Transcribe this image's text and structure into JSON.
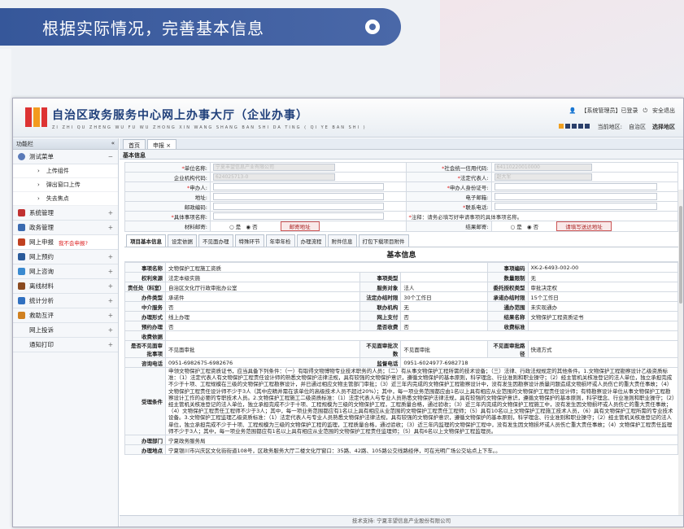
{
  "banner": {
    "title": "根据实际情况，完善基本信息"
  },
  "header": {
    "title": "自治区政务服务中心网上办事大厅（企业办事）",
    "pinyin": "ZI ZHI QU ZHENG WU FU WU ZHONG XIN WANG SHANG BAN SHI DA TING ( QI YE BAN SHI )",
    "user_text": "【系统管理员】已登录",
    "logout": "安全退出",
    "region_label": "当前地区:",
    "region": "自治区",
    "select_region": "选择地区"
  },
  "sidebar": {
    "title": "功能栏",
    "collapse": "«",
    "items": [
      {
        "label": "测试菜单",
        "expanded": true,
        "color": "#5a7ab8"
      },
      {
        "label": "系统管理",
        "color": "#c03030"
      },
      {
        "label": "政务管理",
        "color": "#3a6ab0"
      },
      {
        "label": "网上申报",
        "note": "我不会申报?",
        "color": "#c04020"
      },
      {
        "label": "网上预约",
        "color": "#2a5a9a"
      },
      {
        "label": "网上咨询",
        "color": "#3a8ad0"
      },
      {
        "label": "离线材料",
        "color": "#8a4a20"
      },
      {
        "label": "统计分析",
        "color": "#3070c0"
      },
      {
        "label": "救助互评",
        "color": "#d08020"
      },
      {
        "label": "网上投诉"
      },
      {
        "label": "通知打印"
      }
    ],
    "subitems": [
      "上传组件",
      "弹出窗口上传",
      "失去焦点"
    ]
  },
  "tabs": [
    "首页",
    "申报 ×"
  ],
  "basic_section": "基本信息",
  "form": {
    "unit_name": "单位名称:",
    "unit_name_value": "宁夏丰望信息产业有限公司",
    "credit_code": "社会统一信用代码:",
    "credit_code_value": "64110220010000",
    "org_code": "企业机构代码:",
    "org_code_value": "624025713-0",
    "legal_rep": "法定代表人:",
    "legal_rep_value": "赵大军",
    "applicant": "申办人:",
    "applicant_id": "申办人身份证号:",
    "address": "地址:",
    "email": "电子邮箱:",
    "postcode": "邮政编码:",
    "phone": "联系电话:",
    "item_name": "具体事项名称:",
    "note": "注释：请务必填写好申请事项的具体事项名称。",
    "material_mail": "材料邮寄:",
    "result_mail": "结果邮寄:",
    "yes": "是",
    "no": "否",
    "mail_addr_btn": "邮寄地址",
    "fill_mail_btn": "请填写送达地址"
  },
  "subtabs": [
    "项目基本信息",
    "设定依据",
    "不见面办理",
    "特殊环节",
    "年审年检",
    "办理流程",
    "附件信息",
    "打包下载项目附件"
  ],
  "info": {
    "title": "基本信息",
    "rows": [
      [
        "事项名称",
        "文物保护工程施工资质",
        "",
        "",
        "事项编码",
        "XK-2-6493-002-00"
      ],
      [
        "权利来源",
        "法定本级实施",
        "事项类型",
        "",
        "数量限制",
        "无"
      ],
      [
        "责任处（科室）",
        "自治区文化厅行政审批办公室",
        "服务对象",
        "法人",
        "委托授权类型",
        "审批决定权"
      ],
      [
        "办件类型",
        "承诺件",
        "法定办结时限",
        "30个工作日",
        "承诺办结时限",
        "15个工作日"
      ],
      [
        "中介服务",
        "否",
        "联办机构",
        "无",
        "通办范围",
        "未实现通办"
      ],
      [
        "办理形式",
        "线上办理",
        "网上支付",
        "否",
        "结果名称",
        "文物保护工程资质证书"
      ],
      [
        "预约办理",
        "否",
        "是否收费",
        "否",
        "收费标准",
        ""
      ]
    ],
    "fee_basis": "收费依据",
    "offline_label": "是否不见面审批事项",
    "offline_value": "不见面审批",
    "offline_times_label": "不见面审批次数",
    "offline_times": "不见面审批",
    "offline_type_label": "不见面审批路径",
    "offline_type": "快递方式",
    "consult_label": "咨询电话",
    "consult": "0951-6982675-6982676",
    "supervise_label": "监督电话",
    "supervise": "0951-6024977-6982718",
    "cond_label": "受理条件",
    "cond": "申领文物保护工程资质证书，应当具备下列条件：（一）有取得文物博物专业技术职务的人员；（二）有从事文物保护工程所需的技术设备；（三）法律、行政法规规定的其他条件。1.文物保护工程勘察设计乙级资质标准：（1）法定代表人有文物保护工程责任设计师的熟悉文物保护法律法规，具有较强的文物保护意识，遵循文物保护的基本原则，科学理念、行业准则和职业操守；（2）经主管机关核准登记的法人单位，独立承担完成不少于十项、工程规模在三级的文物保护工程勘察设计，并已通过相应文物主管部门审批；（3）近三年内完成的文物保护工程勘察设计中，没有发生因勘察设计质量问题造成文物损坏或人员伤亡的重大责任事故；（4）文物保护工程责任设计师不少于3人（其中应精并需在该单位的高级技术人员不超过20%）；其中，每一项业务范围都应由1名以上具有相应从业范围的文物保护工程责任设计师；有特勘察设计单位从事文物保护工程勘察设计工作的必要的专职技术人员。2.文物保护工程施工二级资质标准：（1）法定代表人与专业人员熟悉文物保护法律法规，具有较强的文物保护意识，遵循文物保护的基本原则，科学理念、行业准则和职业操守；（2）经主管机关核准登记的法人单位，独立承担完成不少于十项、工程规模为三级的文物保护工程，工程质量合格，通过验收；（3）近三年内完成的文物保护工程施工中，没有发生因文物损坏或人员伤亡的重大责任事故；（4）文物保护工程责任工程师不少于3人；其中，每一项业务范围都应有1名以上具有相应从业范围的文物保护工程责任工程师；（5）具有10名以上文物保护工程施工技术人员，（6）具有文物保护工程所需的专业技术设备。3.文物保护工程监理乙级资质标准：（1）法定代表人与专业人员熟悉文物保护法律法规，具有较强的文物保护意识，遵循文物保护的基本原则，科学理念、行业准则和职业操守；（2）经主管机关核准登记的法人单位，独立承担完成不少于十项、工程规模为三级的文物保护工程的监理，工程质量合格，通过验收；（3）近三年内监理的文物保护工程中，没有发生因文物损坏或人员伤亡重大责任事故；（4）文物保护工程责任监理师不少于3人；其中，每一项业务范围都应有1名以上具有相应从业范围的文物保护工程责任监理师；（5）具有6名以上文物保护工程监理员。",
    "office_label": "办理部门",
    "office": "宁夏政务服务局",
    "addr_label": "办理地点",
    "addr": "宁夏银川市兴庆区文化街街道108号，区政务服务大厅二楼文化厅窗口：35路、42路、105路公交线路经停，可在光明广场公交站点上下车。。"
  },
  "footer": "技术支持: 宁夏丰望信息产业股份有限公司"
}
